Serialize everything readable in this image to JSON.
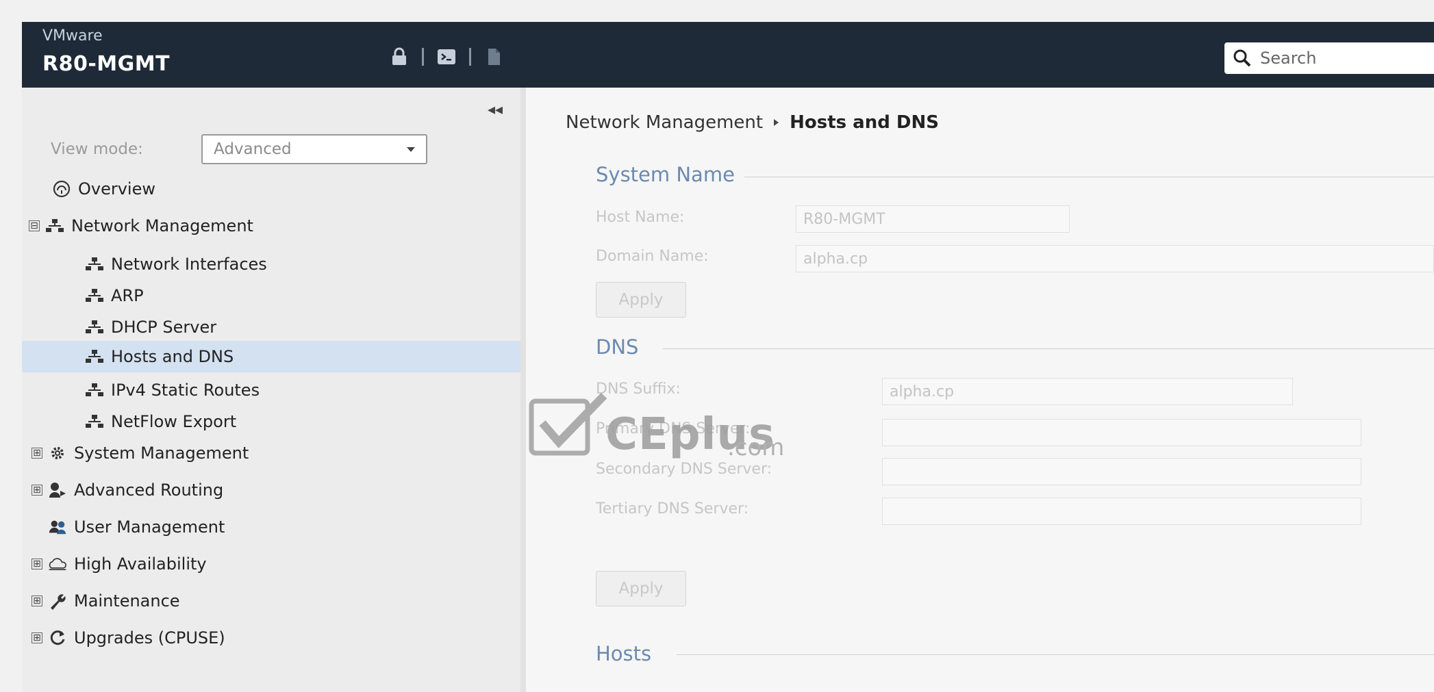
{
  "header": {
    "vendor": "VMware",
    "host": "R80-MGMT",
    "toolbar_icons": [
      "lock-icon",
      "terminal-icon",
      "document-icon"
    ],
    "search_placeholder": "Search"
  },
  "sidebar": {
    "collapse_glyph": "◂◂",
    "view_mode_label": "View mode:",
    "view_mode_value": "Advanced",
    "items": [
      {
        "label": "Overview",
        "icon": "overview-icon"
      },
      {
        "label": "Network Management",
        "icon": "network-icon",
        "expander": "⊟"
      },
      {
        "label": "Network Interfaces",
        "icon": "network-icon"
      },
      {
        "label": "ARP",
        "icon": "network-icon"
      },
      {
        "label": "DHCP Server",
        "icon": "network-icon"
      },
      {
        "label": "Hosts and DNS",
        "icon": "network-icon",
        "selected": true
      },
      {
        "label": "IPv4 Static Routes",
        "icon": "network-icon"
      },
      {
        "label": "NetFlow Export",
        "icon": "network-icon"
      },
      {
        "label": "System Management",
        "icon": "gear-icon",
        "expander": "⊞"
      },
      {
        "label": "Advanced Routing",
        "icon": "routing-icon",
        "expander": "⊞"
      },
      {
        "label": "User Management",
        "icon": "users-icon",
        "expander": "⊞"
      },
      {
        "label": "High Availability",
        "icon": "cloud-icon",
        "expander": "⊞"
      },
      {
        "label": "Maintenance",
        "icon": "wrench-icon",
        "expander": "⊞"
      },
      {
        "label": "Upgrades (CPUSE)",
        "icon": "refresh-icon",
        "expander": "⊞"
      }
    ]
  },
  "main": {
    "breadcrumb_parent": "Network Management",
    "breadcrumb_current": "Hosts and DNS",
    "system_name": {
      "title": "System Name",
      "host_name_label": "Host Name:",
      "host_name_value": "R80-MGMT",
      "domain_name_label": "Domain Name:",
      "domain_name_value": "alpha.cp",
      "apply_label": "Apply"
    },
    "dns": {
      "title": "DNS",
      "suffix_label": "DNS Suffix:",
      "suffix_value": "alpha.cp",
      "primary_label": "Primary DNS Server:",
      "primary_value": "",
      "secondary_label": "Secondary DNS Server:",
      "secondary_value": "",
      "tertiary_label": "Tertiary DNS Server:",
      "tertiary_value": "",
      "apply_label": "Apply"
    },
    "hosts": {
      "title": "Hosts"
    }
  },
  "watermark": {
    "text": "CEplus",
    "suffix": ".com"
  },
  "colors": {
    "topbar": "#1f2a38",
    "selected_row": "#d3e1f1",
    "section_title": "#6a8ab0"
  }
}
